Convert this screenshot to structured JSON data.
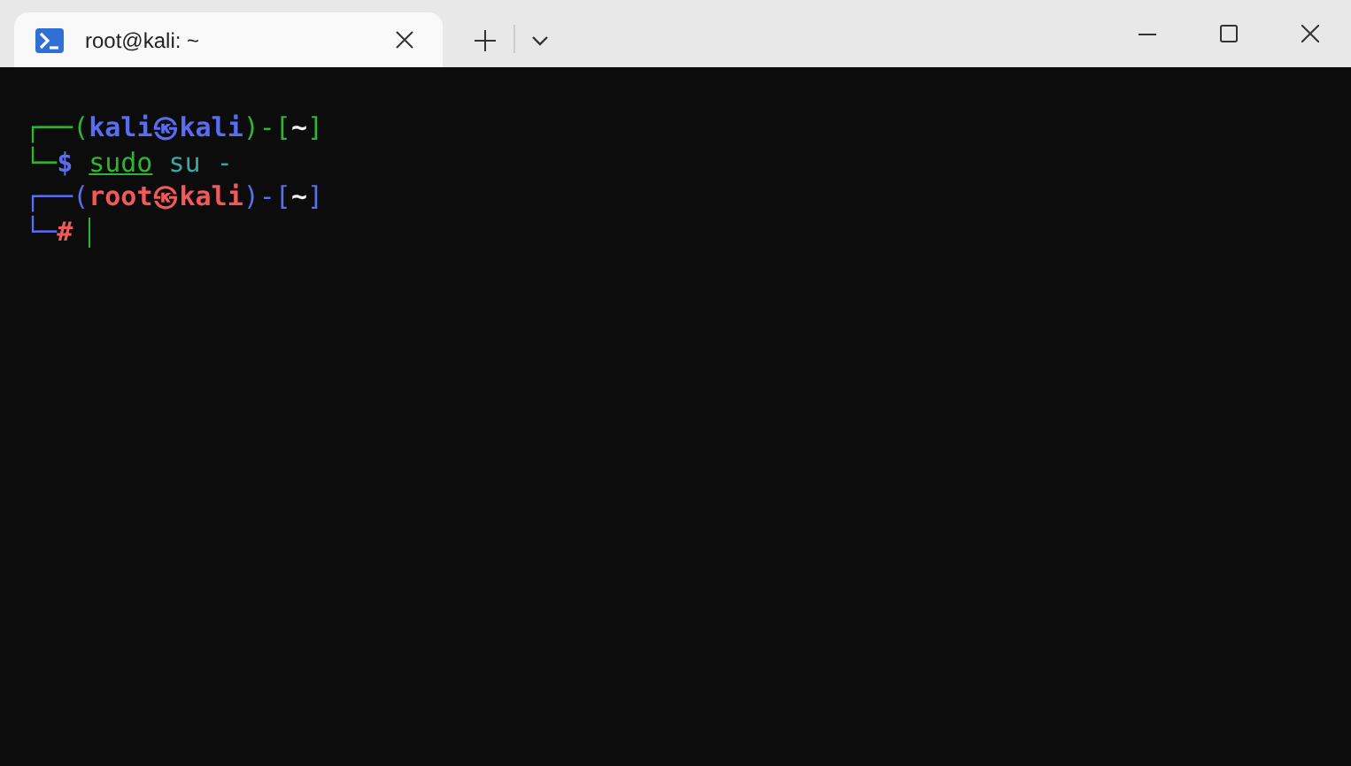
{
  "tabs": [
    {
      "title": "root@kali: ~",
      "selected": true
    }
  ],
  "terminal": {
    "lines": [
      {
        "segments": [
          {
            "text": "┌──(",
            "kind": "frame_user"
          },
          {
            "text": "kali㉿kali",
            "kind": "user"
          },
          {
            "text": ")-[",
            "kind": "frame_user"
          },
          {
            "text": "~",
            "kind": "path"
          },
          {
            "text": "]",
            "kind": "frame_user"
          }
        ]
      },
      {
        "segments": [
          {
            "text": "└─",
            "kind": "frame_user"
          },
          {
            "text": "$",
            "kind": "prompt_user"
          },
          {
            "text": "sudo",
            "kind": "command"
          },
          {
            "text": " su -",
            "kind": "argument"
          }
        ]
      },
      {
        "segments": [
          {
            "text": "┌──(",
            "kind": "frame_root"
          },
          {
            "text": "root㉿kali",
            "kind": "root"
          },
          {
            "text": ")-[",
            "kind": "frame_root"
          },
          {
            "text": "~",
            "kind": "path"
          },
          {
            "text": "]",
            "kind": "frame_root"
          }
        ]
      },
      {
        "segments": [
          {
            "text": "└─",
            "kind": "frame_root"
          },
          {
            "text": "#",
            "kind": "prompt_root"
          }
        ],
        "cursor": true
      }
    ]
  }
}
